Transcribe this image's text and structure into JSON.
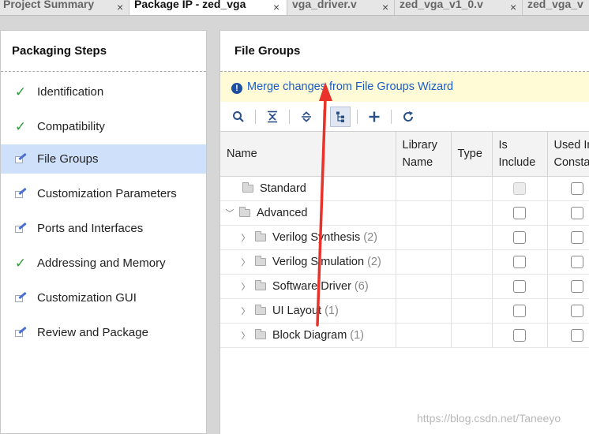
{
  "tabs": [
    {
      "label": "Project Summary",
      "active": false
    },
    {
      "label": "Package IP - zed_vga",
      "active": true
    },
    {
      "label": "vga_driver.v",
      "active": false
    },
    {
      "label": "zed_vga_v1_0.v",
      "active": false
    },
    {
      "label": "zed_vga_v",
      "active": false
    }
  ],
  "tab_close_glyph": "×",
  "packaging_steps": {
    "title": "Packaging Steps",
    "items": [
      {
        "label": "Identification",
        "status": "check"
      },
      {
        "label": "Compatibility",
        "status": "check"
      },
      {
        "label": "File Groups",
        "status": "edit",
        "selected": true
      },
      {
        "label": "Customization Parameters",
        "status": "edit"
      },
      {
        "label": "Ports and Interfaces",
        "status": "edit"
      },
      {
        "label": "Addressing and Memory",
        "status": "check"
      },
      {
        "label": "Customization GUI",
        "status": "edit"
      },
      {
        "label": "Review and Package",
        "status": "edit"
      }
    ]
  },
  "file_groups": {
    "title": "File Groups",
    "banner_text": "Merge changes from File Groups Wizard",
    "toolbar": [
      "search-icon",
      "collapse-all-icon",
      "expand-all-icon",
      "hierarchy-icon",
      "add-icon",
      "refresh-icon"
    ],
    "columns": {
      "name": "Name",
      "library_name": "Library Name",
      "type": "Type",
      "is_include": "Is Include",
      "used_in": "Used In Consta"
    },
    "rows": [
      {
        "name": "Standard",
        "count": "",
        "expander": "",
        "indent": 1
      },
      {
        "name": "Advanced",
        "count": "",
        "expander": "expanded",
        "indent": 0
      },
      {
        "name": "Verilog Synthesis",
        "count": "(2)",
        "expander": "collapsed",
        "indent": 2
      },
      {
        "name": "Verilog Simulation",
        "count": "(2)",
        "expander": "collapsed",
        "indent": 2
      },
      {
        "name": "Software Driver",
        "count": "(6)",
        "expander": "collapsed",
        "indent": 2
      },
      {
        "name": "UI Layout",
        "count": "(1)",
        "expander": "collapsed",
        "indent": 2
      },
      {
        "name": "Block Diagram",
        "count": "(1)",
        "expander": "collapsed",
        "indent": 2
      }
    ]
  },
  "watermark": "https://blog.csdn.net/Taneeyo",
  "colors": {
    "selected_row": "#cfe0fa",
    "banner_bg": "#fffbd6",
    "link_blue": "#1a5ccc",
    "check_green": "#2e9a3a",
    "annotation_red": "#e8322a"
  }
}
